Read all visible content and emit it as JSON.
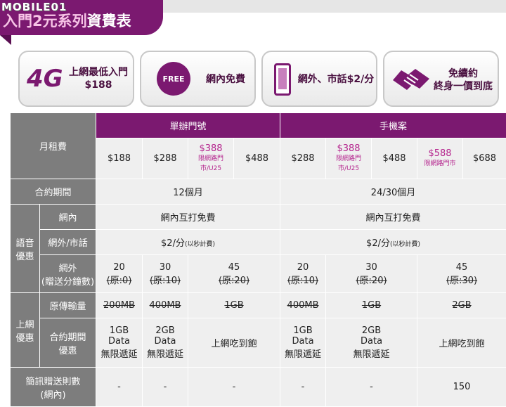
{
  "header": {
    "logo": "MOBILE01",
    "title_highlight": "入門2元系列",
    "title_rest": "資費表"
  },
  "features": [
    {
      "badge": "4G",
      "line1": "上網最低入門",
      "line2": "$188"
    },
    {
      "badge": "FREE",
      "line1": "網內免費"
    },
    {
      "line1": "網外、市話$2/分"
    },
    {
      "line1": "免續約",
      "line2": "終身一價到底"
    }
  ],
  "table": {
    "groups": {
      "single": "單辦門號",
      "phone": "手機案"
    },
    "rows": {
      "monthly": "月租費",
      "contract": "合約期間",
      "voice": "語音\n優惠",
      "onnet": "網內",
      "offnet_landline": "網外/市話",
      "offnet_free_l1": "網外",
      "offnet_free_l2": "(贈送分鐘數)",
      "data": "上網\n優惠",
      "orig_volume": "原傳輸量",
      "contract_benefit_l1": "合約期間",
      "contract_benefit_l2": "優惠",
      "sms_l1": "簡訊贈送則數",
      "sms_l2": "(網內)"
    },
    "monthly": {
      "single": [
        "$188",
        "$288",
        "$388",
        "$488"
      ],
      "single_388_note_l1": "限網路門",
      "single_388_note_l2": "市/U25",
      "phone": [
        "$288",
        "$388",
        "$488",
        "$588",
        "$688"
      ],
      "phone_388_note_l1": "限網路門",
      "phone_388_note_l2": "市/U25",
      "phone_588_note": "限網路門市"
    },
    "contract": {
      "single": "12個月",
      "phone": "24/30個月"
    },
    "onnet": {
      "single": "網內互打免費",
      "phone": "網內互打免費"
    },
    "offnet_rate": {
      "value": "$2/分",
      "note": "(以秒計費)"
    },
    "offnet_minutes": {
      "single": [
        {
          "v": "20",
          "o": "(原:0)"
        },
        {
          "v": "30",
          "o": "(原:10)"
        },
        {
          "v": "45",
          "o": "(原:20)"
        }
      ],
      "phone": [
        {
          "v": "20",
          "o": "(原:10)"
        },
        {
          "v": "30",
          "o": "(原:20)"
        },
        {
          "v": "45",
          "o": "(原:30)"
        }
      ]
    },
    "orig_volume": {
      "single": [
        "200MB",
        "400MB",
        "1GB"
      ],
      "phone": [
        "400MB",
        "1GB",
        "2GB"
      ]
    },
    "benefit": {
      "g1": {
        "l1": "1GB",
        "l2": "Data",
        "l3": "無限遞延"
      },
      "g2": {
        "l1": "2GB",
        "l2": "Data",
        "l3": "無限遞延"
      },
      "unlimited": "上網吃到飽"
    },
    "sms": {
      "dash": "-",
      "last": "150"
    }
  }
}
